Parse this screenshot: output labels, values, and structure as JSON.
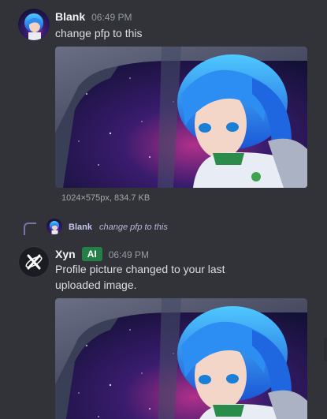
{
  "messages": [
    {
      "author": "Blank",
      "time": "06:49 PM",
      "text": "change pfp to this",
      "attachment_info": "1024×575px, 834.7 KB"
    },
    {
      "author": "Xyn",
      "badge": "AI",
      "time": "06:49 PM",
      "text": "Profile picture changed to your last uploaded image.",
      "reply": {
        "author": "Blank",
        "text": "change pfp to this"
      }
    }
  ],
  "icons": {
    "xyn_avatar": "x-logo-icon",
    "blank_avatar": "anime-avatar"
  },
  "colors": {
    "background": "#323338",
    "ai_badge": "#248046",
    "accent": "#3ab0ff"
  }
}
